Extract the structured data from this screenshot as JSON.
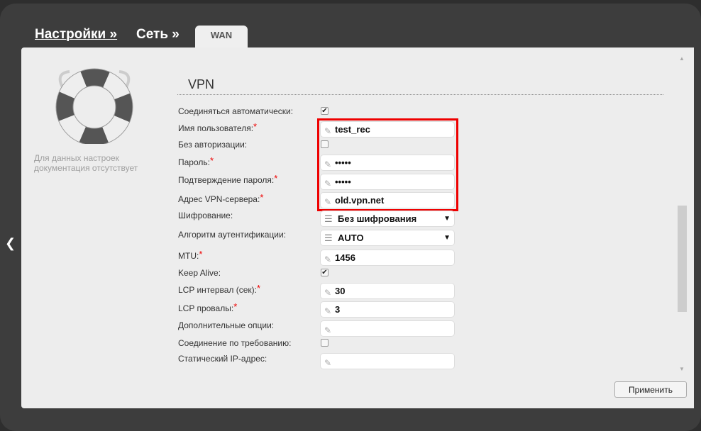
{
  "breadcrumb": {
    "settings": "Настройки »",
    "network": "Сеть »",
    "tab": "WAN"
  },
  "help": {
    "no_docs": "Для данных настроек документация отсутствует"
  },
  "section": {
    "title": "VPN"
  },
  "fields": {
    "auto_connect": {
      "label": "Соединяться автоматически:",
      "checked": true
    },
    "username": {
      "label": "Имя пользователя:",
      "value": "test_rec"
    },
    "no_auth": {
      "label": "Без авторизации:",
      "checked": false
    },
    "password": {
      "label": "Пароль:",
      "value": "•••••"
    },
    "password_confirm": {
      "label": "Подтверждение пароля:",
      "value": "•••••"
    },
    "server": {
      "label": "Адрес VPN-сервера:",
      "value": "old.vpn.net"
    },
    "encryption": {
      "label": "Шифрование:",
      "value": "Без шифрования"
    },
    "auth_algo": {
      "label": "Алгоритм аутентификации:",
      "value": "AUTO"
    },
    "mtu": {
      "label": "MTU:",
      "value": "1456"
    },
    "keep_alive": {
      "label": "Keep Alive:",
      "checked": true
    },
    "lcp_interval": {
      "label": "LCP интервал (сек):",
      "value": "30"
    },
    "lcp_fails": {
      "label": "LCP провалы:",
      "value": "3"
    },
    "extra_options": {
      "label": "Дополнительные опции:",
      "value": ""
    },
    "on_demand": {
      "label": "Соединение по требованию:",
      "checked": false
    },
    "static_ip": {
      "label": "Статический IP-адрес:",
      "value": ""
    }
  },
  "required_mark": "*",
  "check_mark": "✔",
  "apply_label": "Применить"
}
